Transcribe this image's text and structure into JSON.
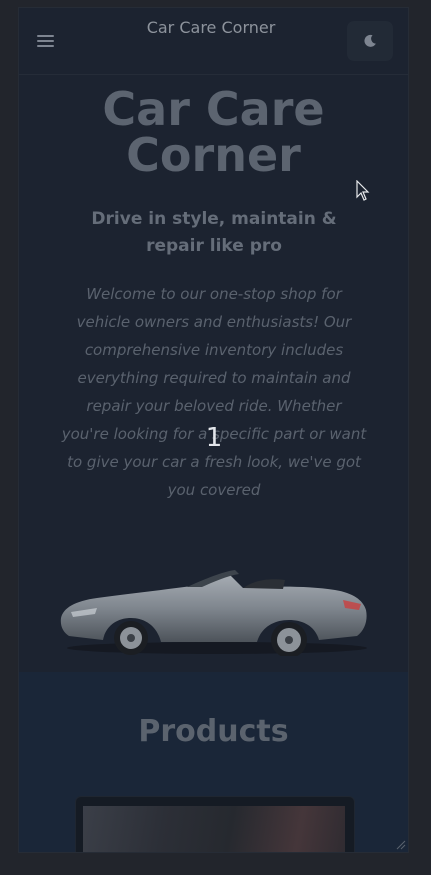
{
  "header": {
    "brand": "Car Care Corner",
    "menu_icon": "hamburger-menu-icon",
    "theme_icon": "moon-icon"
  },
  "hero": {
    "title": "Car Care Corner",
    "subtitle": "Drive in style, maintain & repair like pro",
    "description": "Welcome to our one-stop shop for vehicle owners and enthusiasts! Our comprehensive inventory includes everything required to maintain and repair your beloved ride. Whether you're looking for a specific part or want to give your car a fresh look, we've got you covered",
    "carousel_indicator": "1"
  },
  "products": {
    "title": "Products"
  },
  "colors": {
    "page_bg": "#22252c",
    "frame_bg": "#1c2330",
    "products_bg": "#1a2638",
    "carousel_text": "#e2e5ea"
  }
}
